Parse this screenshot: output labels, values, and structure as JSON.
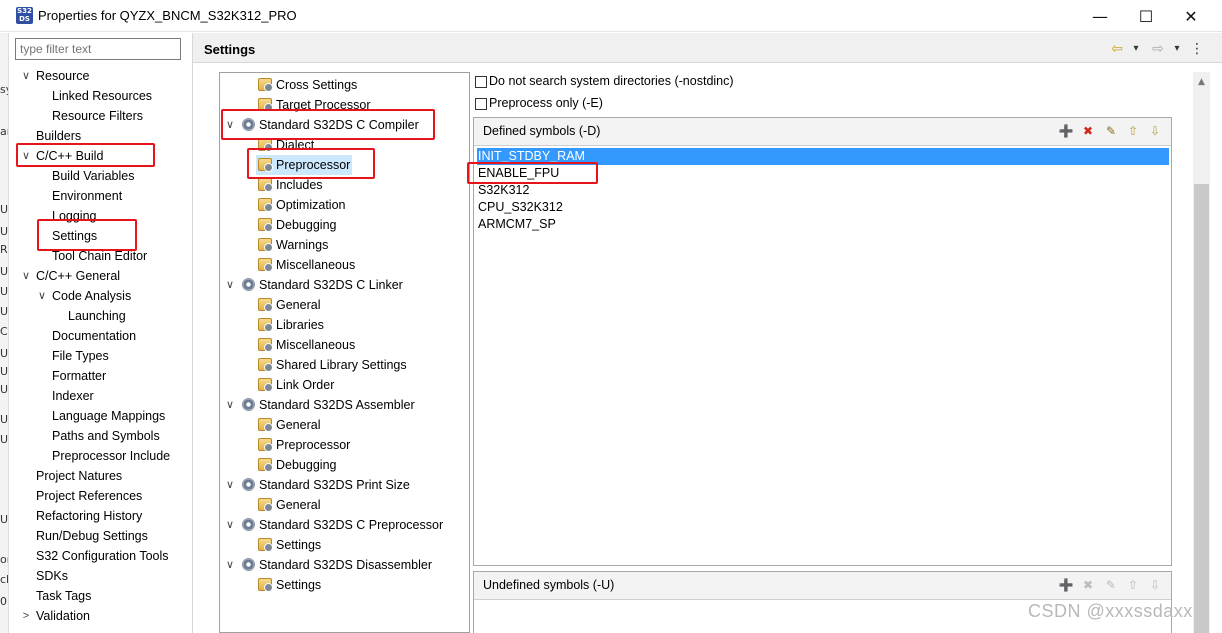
{
  "window": {
    "title": "Properties for QYZX_BNCM_S32K312_PRO",
    "app_icon_text": "S32\nDS",
    "minimize": "—",
    "maximize": "☐",
    "close": "✕"
  },
  "bleed_chars": [
    "sy",
    "ar",
    "U",
    "U",
    "R",
    "U",
    "U",
    "U",
    "C",
    "U",
    "U",
    "U",
    "U",
    "U",
    "U",
    "or",
    "cl",
    "0"
  ],
  "filter": {
    "placeholder": "type filter text"
  },
  "nav": {
    "items": [
      {
        "label": "Resource",
        "level": 0,
        "chevron": "open"
      },
      {
        "label": "Linked Resources",
        "level": 1
      },
      {
        "label": "Resource Filters",
        "level": 1
      },
      {
        "label": "Builders",
        "level": 0
      },
      {
        "label": "C/C++ Build",
        "level": 0,
        "chevron": "open"
      },
      {
        "label": "Build Variables",
        "level": 1
      },
      {
        "label": "Environment",
        "level": 1
      },
      {
        "label": "Logging",
        "level": 1
      },
      {
        "label": "Settings",
        "level": 1,
        "selected": true
      },
      {
        "label": "Tool Chain Editor",
        "level": 1
      },
      {
        "label": "C/C++ General",
        "level": 0,
        "chevron": "open"
      },
      {
        "label": "Code Analysis",
        "level": 1,
        "chevron": "open"
      },
      {
        "label": "Launching",
        "level": 2
      },
      {
        "label": "Documentation",
        "level": 1
      },
      {
        "label": "File Types",
        "level": 1
      },
      {
        "label": "Formatter",
        "level": 1
      },
      {
        "label": "Indexer",
        "level": 1
      },
      {
        "label": "Language Mappings",
        "level": 1
      },
      {
        "label": "Paths and Symbols",
        "level": 1
      },
      {
        "label": "Preprocessor Include",
        "level": 1
      },
      {
        "label": "Project Natures",
        "level": 0
      },
      {
        "label": "Project References",
        "level": 0
      },
      {
        "label": "Refactoring History",
        "level": 0
      },
      {
        "label": "Run/Debug Settings",
        "level": 0
      },
      {
        "label": "S32 Configuration Tools",
        "level": 0
      },
      {
        "label": "SDKs",
        "level": 0
      },
      {
        "label": "Task Tags",
        "level": 0
      },
      {
        "label": "Validation",
        "level": 0,
        "chevron": "closed"
      }
    ]
  },
  "header": {
    "title": "Settings",
    "back_icon": "⇦",
    "forward_icon": "⇨",
    "menu_icon": "⋮",
    "dropdown_icon": "▾"
  },
  "tool_tree": {
    "items": [
      {
        "label": "Cross Settings",
        "level": 1,
        "icon": "folder-gear"
      },
      {
        "label": "Target Processor",
        "level": 1,
        "icon": "folder-gear"
      },
      {
        "label": "Standard S32DS C Compiler",
        "level": 0,
        "icon": "gear",
        "chevron": "open"
      },
      {
        "label": "Dialect",
        "level": 1,
        "icon": "folder-gear"
      },
      {
        "label": "Preprocessor",
        "level": 1,
        "icon": "folder-gear",
        "selected": true
      },
      {
        "label": "Includes",
        "level": 1,
        "icon": "folder-gear"
      },
      {
        "label": "Optimization",
        "level": 1,
        "icon": "folder-gear"
      },
      {
        "label": "Debugging",
        "level": 1,
        "icon": "folder-gear"
      },
      {
        "label": "Warnings",
        "level": 1,
        "icon": "folder-gear"
      },
      {
        "label": "Miscellaneous",
        "level": 1,
        "icon": "folder-gear"
      },
      {
        "label": "Standard S32DS C Linker",
        "level": 0,
        "icon": "gear",
        "chevron": "open"
      },
      {
        "label": "General",
        "level": 1,
        "icon": "folder-gear"
      },
      {
        "label": "Libraries",
        "level": 1,
        "icon": "folder-gear"
      },
      {
        "label": "Miscellaneous",
        "level": 1,
        "icon": "folder-gear"
      },
      {
        "label": "Shared Library Settings",
        "level": 1,
        "icon": "folder-gear"
      },
      {
        "label": "Link Order",
        "level": 1,
        "icon": "folder-gear"
      },
      {
        "label": "Standard S32DS Assembler",
        "level": 0,
        "icon": "gear",
        "chevron": "open"
      },
      {
        "label": "General",
        "level": 1,
        "icon": "folder-gear"
      },
      {
        "label": "Preprocessor",
        "level": 1,
        "icon": "folder-gear"
      },
      {
        "label": "Debugging",
        "level": 1,
        "icon": "folder-gear"
      },
      {
        "label": "Standard S32DS Print Size",
        "level": 0,
        "icon": "gear",
        "chevron": "open"
      },
      {
        "label": "General",
        "level": 1,
        "icon": "folder-gear"
      },
      {
        "label": "Standard S32DS C Preprocessor",
        "level": 0,
        "icon": "gear",
        "chevron": "open"
      },
      {
        "label": "Settings",
        "level": 1,
        "icon": "folder-gear"
      },
      {
        "label": "Standard S32DS Disassembler",
        "level": 0,
        "icon": "gear",
        "chevron": "open"
      },
      {
        "label": "Settings",
        "level": 1,
        "icon": "folder-gear"
      }
    ]
  },
  "options": {
    "nostdinc": {
      "label": "Do not search system directories (-nostdinc)",
      "checked": false
    },
    "preprocess_only": {
      "label": "Preprocess only (-E)",
      "checked": false
    }
  },
  "defined_symbols": {
    "title": "Defined symbols (-D)",
    "items": [
      "INIT_STDBY_RAM",
      "ENABLE_FPU",
      "S32K312",
      "CPU_S32K312",
      "ARMCM7_SP"
    ],
    "selected_index": 0
  },
  "undefined_symbols": {
    "title": "Undefined symbols (-U)",
    "items": []
  },
  "tool_icons": {
    "add": "➕",
    "delete": "✖",
    "edit": "✎",
    "up": "⇧",
    "down": "⇩"
  },
  "chevrons": {
    "open": "∨",
    "closed": ">"
  },
  "watermark": "CSDN @xxxssdaxx",
  "colors": {
    "selection": "#3399ff",
    "tree_selection": "#cce8ff",
    "annotation": "#e8141c"
  }
}
